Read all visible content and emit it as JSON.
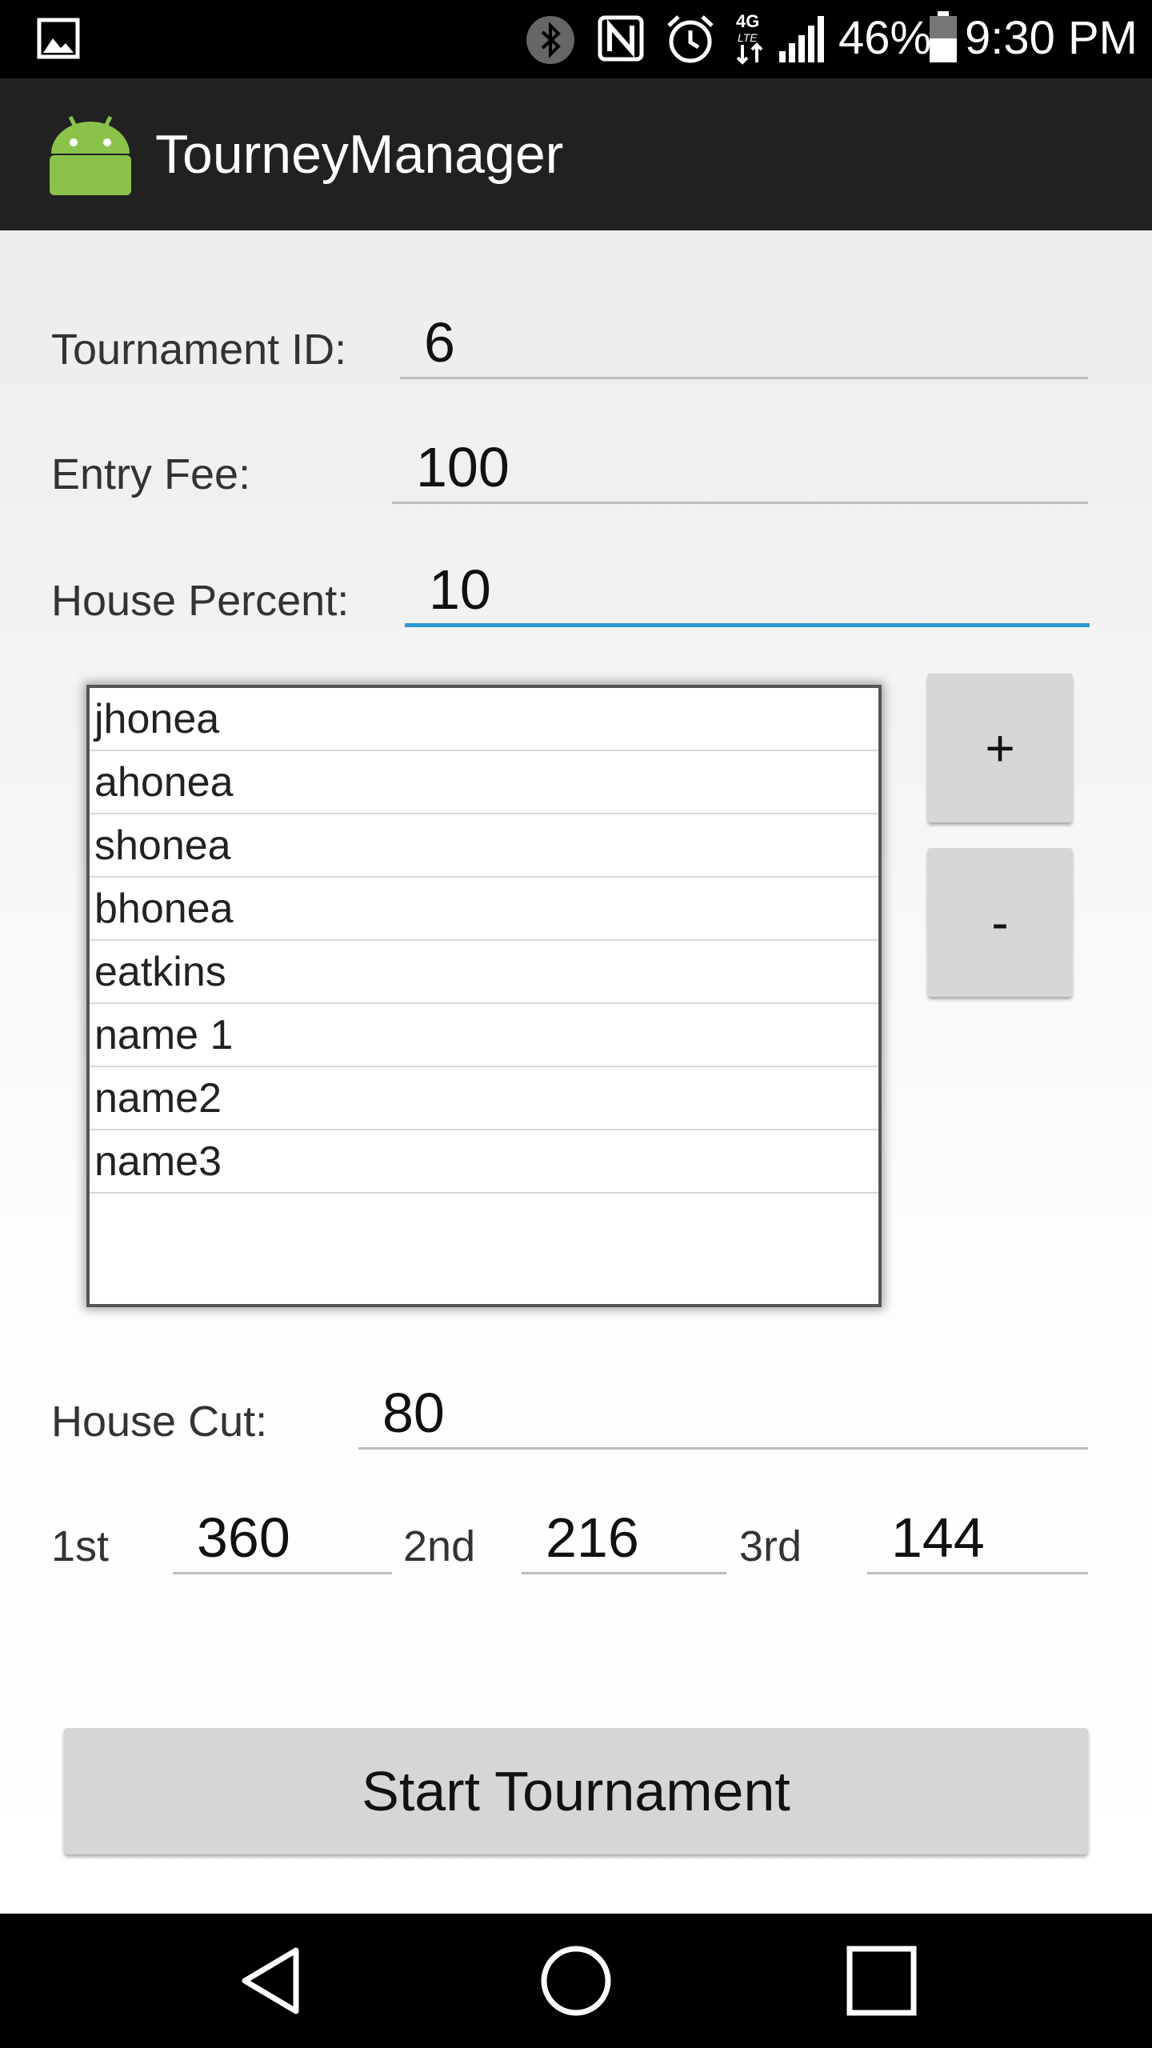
{
  "status_bar": {
    "battery": "46%",
    "time": "9:30 PM",
    "icons": [
      "gallery-icon",
      "bluetooth-icon",
      "nfc-icon",
      "alarm-icon",
      "4g-lte-icon",
      "signal-icon",
      "battery-icon"
    ]
  },
  "app_bar": {
    "title": "TourneyManager",
    "logo": "android-robot-icon"
  },
  "form": {
    "tournament_id_label": "Tournament ID:",
    "tournament_id_value": "6",
    "entry_fee_label": "Entry Fee:",
    "entry_fee_value": "100",
    "house_percent_label": "House Percent:",
    "house_percent_value": "10"
  },
  "players": [
    "jhonea",
    "ahonea",
    "shonea",
    "bhonea",
    "eatkins",
    "name 1",
    "name2",
    "name3"
  ],
  "buttons": {
    "add_label": "+",
    "remove_label": "-",
    "start_label": "Start Tournament"
  },
  "payout": {
    "house_cut_label": "House Cut:",
    "house_cut_value": "80",
    "first_label": "1st",
    "first_value": "360",
    "second_label": "2nd",
    "second_value": "216",
    "third_label": "3rd",
    "third_value": "144"
  },
  "colors": {
    "accent": "#2a9ad5",
    "appbar": "#212121",
    "android_green": "#8bc34a"
  },
  "nav_bar": {
    "icons": [
      "back-icon",
      "home-icon",
      "recents-icon"
    ]
  }
}
